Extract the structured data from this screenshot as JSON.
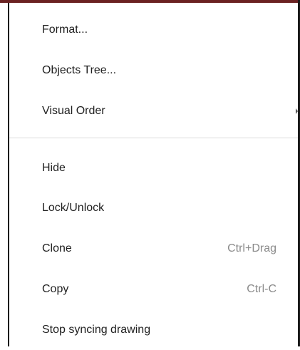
{
  "menu": {
    "items": [
      {
        "label": "Format...",
        "shortcut": ""
      },
      {
        "label": "Objects Tree...",
        "shortcut": ""
      },
      {
        "label": "Visual Order",
        "shortcut": "",
        "submenu": true
      },
      {
        "label": "Hide",
        "shortcut": ""
      },
      {
        "label": "Lock/Unlock",
        "shortcut": ""
      },
      {
        "label": "Clone",
        "shortcut": "Ctrl+Drag"
      },
      {
        "label": "Copy",
        "shortcut": "Ctrl-C"
      },
      {
        "label": "Stop syncing drawing",
        "shortcut": ""
      }
    ]
  }
}
